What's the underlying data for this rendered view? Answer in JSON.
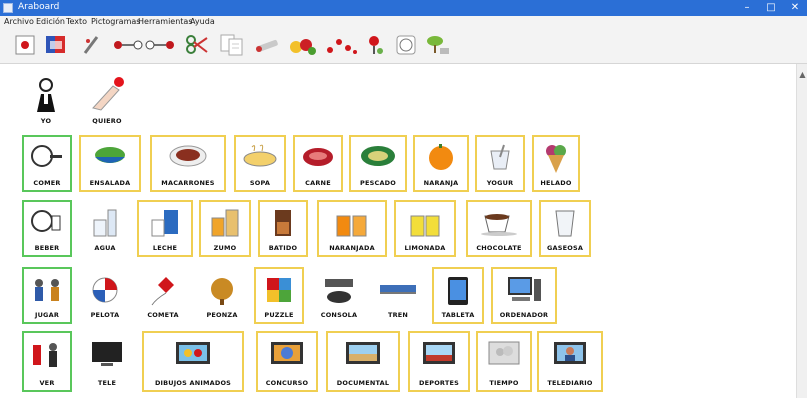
{
  "window": {
    "title": "Araboard",
    "controls": {
      "minimize": "–",
      "maximize": "□",
      "close": "✕"
    }
  },
  "menu": [
    "Archivo",
    "Edición",
    "Texto",
    "Pictogramas",
    "Herramientas",
    "Ayuda"
  ],
  "toolbar": {
    "icons": [
      "record-icon",
      "book-icon",
      "pen-icon",
      "link-chain-icon",
      "scissors-icon",
      "copy-icon",
      "tools-icon",
      "fruits-icon",
      "dots-icon",
      "pin-icon",
      "clock-icon",
      "tree-icon"
    ]
  },
  "board": {
    "rows": [
      {
        "cells": [
          {
            "label": "YO",
            "kind": "plain"
          },
          {
            "label": "QUIERO",
            "kind": "plain"
          }
        ]
      },
      {
        "cells": [
          {
            "label": "COMER",
            "kind": "verb"
          },
          {
            "label": "ENSALADA",
            "kind": "noun"
          },
          {
            "label": "MACARRONES",
            "kind": "noun"
          },
          {
            "label": "SOPA",
            "kind": "noun"
          },
          {
            "label": "CARNE",
            "kind": "noun"
          },
          {
            "label": "PESCADO",
            "kind": "noun"
          },
          {
            "label": "NARANJA",
            "kind": "noun"
          },
          {
            "label": "YOGUR",
            "kind": "noun"
          },
          {
            "label": "HELADO",
            "kind": "noun"
          }
        ]
      },
      {
        "cells": [
          {
            "label": "BEBER",
            "kind": "verb"
          },
          {
            "label": "AGUA",
            "kind": "noun"
          },
          {
            "label": "LECHE",
            "kind": "noun"
          },
          {
            "label": "ZUMO",
            "kind": "noun"
          },
          {
            "label": "BATIDO",
            "kind": "noun"
          },
          {
            "label": "NARANJADA",
            "kind": "noun"
          },
          {
            "label": "LIMONADA",
            "kind": "noun"
          },
          {
            "label": "CHOCOLATE",
            "kind": "noun"
          },
          {
            "label": "GASEOSA",
            "kind": "noun"
          }
        ]
      },
      {
        "cells": [
          {
            "label": "JUGAR",
            "kind": "verb"
          },
          {
            "label": "PELOTA",
            "kind": "noun"
          },
          {
            "label": "COMETA",
            "kind": "noun"
          },
          {
            "label": "PEONZA",
            "kind": "noun"
          },
          {
            "label": "PUZZLE",
            "kind": "noun"
          },
          {
            "label": "CONSOLA",
            "kind": "noun"
          },
          {
            "label": "TREN",
            "kind": "noun"
          },
          {
            "label": "TABLETA",
            "kind": "noun"
          },
          {
            "label": "ORDENADOR",
            "kind": "noun"
          }
        ]
      },
      {
        "cells": [
          {
            "label": "VER",
            "kind": "verb"
          },
          {
            "label": "TELE",
            "kind": "noun"
          },
          {
            "label": "DIBUJOS ANIMADOS",
            "kind": "noun"
          },
          {
            "label": "CONCURSO",
            "kind": "noun"
          },
          {
            "label": "DOCUMENTAL",
            "kind": "noun"
          },
          {
            "label": "DEPORTES",
            "kind": "noun"
          },
          {
            "label": "TIEMPO",
            "kind": "noun"
          },
          {
            "label": "TELEDIARIO",
            "kind": "noun"
          }
        ]
      }
    ]
  },
  "colors": {
    "verb_border": "#59c75b",
    "noun_border": "#f0cf52",
    "titlebar": "#2b6fd6"
  }
}
